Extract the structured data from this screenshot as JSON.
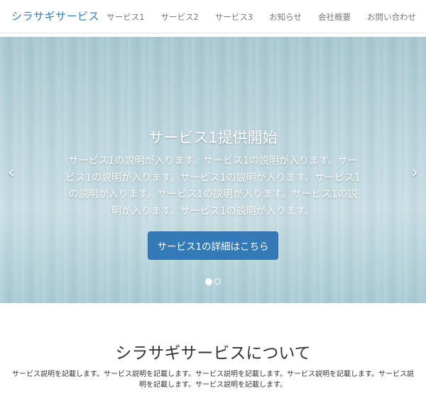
{
  "header": {
    "brand": "シラサギサービス",
    "nav": [
      "サービス1",
      "サービス2",
      "サービス3",
      "お知らせ",
      "会社概要",
      "お問い合わせ"
    ]
  },
  "hero": {
    "title": "サービス1提供開始",
    "description": "サービス1の説明が入ります。サービス1の説明が入ります。サービス1の説明が入ります。サービス1の説明が入ります。サービス1の説明が入ります。サービス1の説明が入ります。サービス1の説明が入ります。サービス1の説明が入ります。",
    "button_label": "サービス1の詳細はこちら",
    "prev_icon": "‹",
    "next_icon": "›",
    "slides_count": 2,
    "active_slide": 1
  },
  "about": {
    "title": "シラサギサービスについて",
    "text": "サービス説明を記載します。サービス説明を記載します。サービス説明を記載します。サービス説明を記載します。サービス説明を記載します。サービス説明を記載します。"
  },
  "colors": {
    "brand": "#337ab7",
    "nav_text": "#777777",
    "button": "#337ab7"
  }
}
